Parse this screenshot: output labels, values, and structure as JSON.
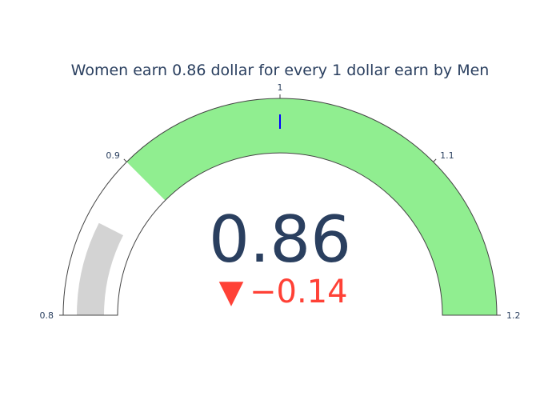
{
  "chart_data": {
    "type": "gauge",
    "title": "Women earn 0.86 dollar for every 1 dollar earn by Men",
    "value": 0.86,
    "value_label": "0.86",
    "reference": 1,
    "delta": -0.14,
    "delta_label": "−0.14",
    "delta_symbol": "▼",
    "range": [
      0.8,
      1.2
    ],
    "tick_values": [
      0.8,
      0.9,
      1,
      1.1,
      1.2
    ],
    "tick_labels": [
      "0.8",
      "0.9",
      "1",
      "1.1",
      "1.2"
    ],
    "steps": [
      {
        "range": [
          0.8,
          0.9
        ],
        "color": "#ffffff"
      },
      {
        "range": [
          0.9,
          1.2
        ],
        "color": "#90ee90"
      }
    ],
    "threshold": {
      "value": 1,
      "color": "#0000ff"
    }
  },
  "colors": {
    "bar": "#d3d3d3",
    "text": "#2a3f5f",
    "delta_decreasing": "#ff4136",
    "outline": "#444444"
  }
}
